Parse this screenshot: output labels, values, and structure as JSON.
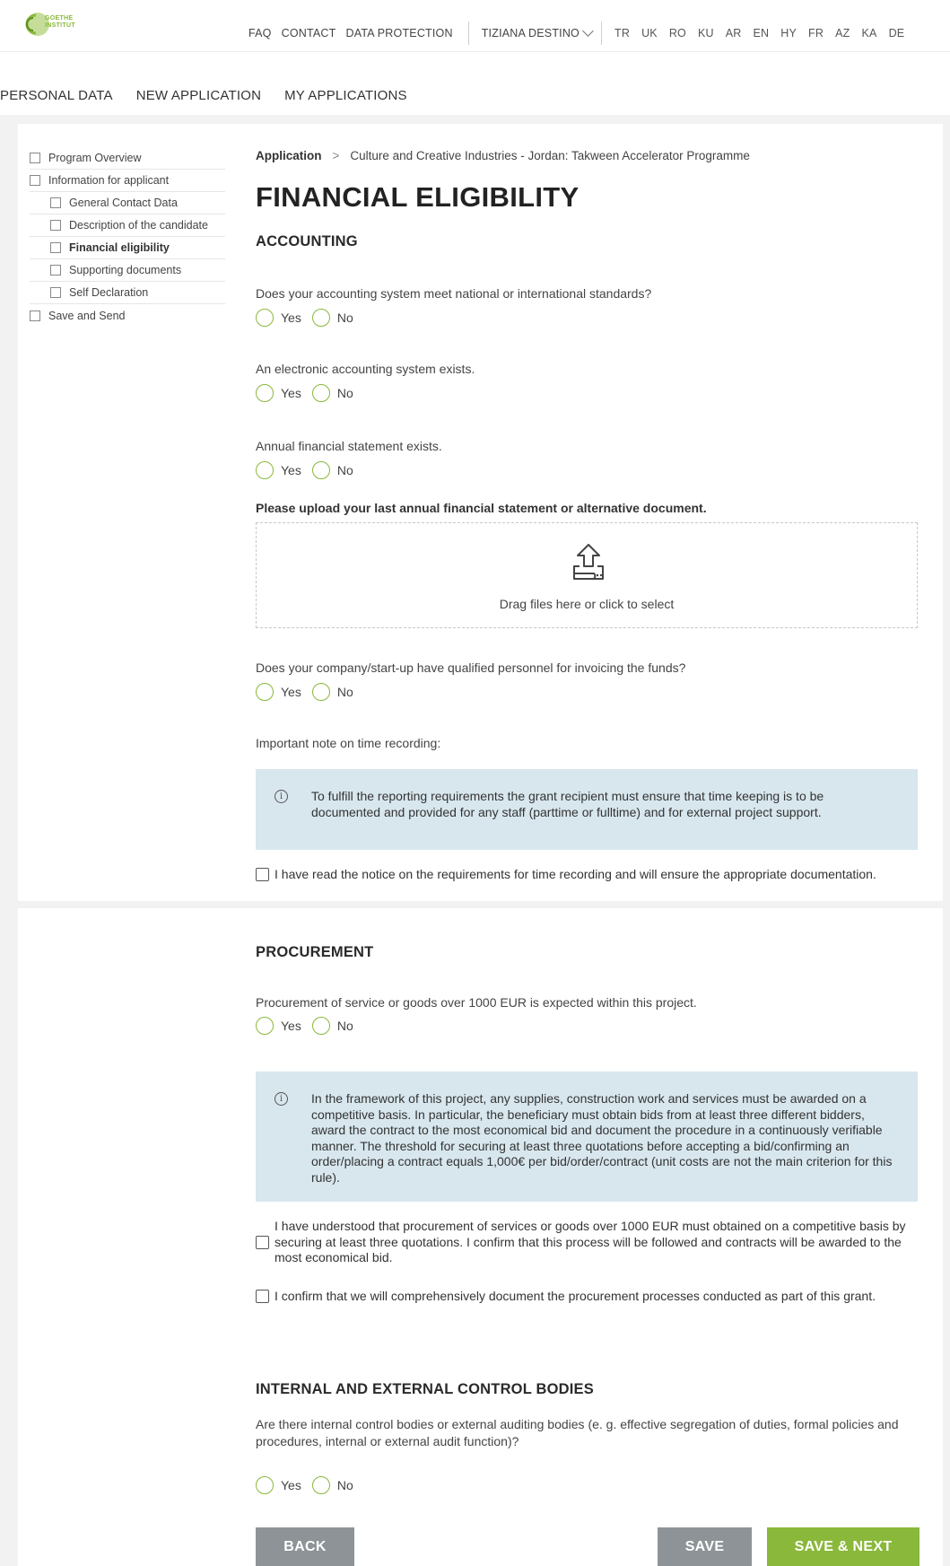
{
  "header": {
    "logo_text_1": "GOETHE",
    "logo_text_2": "INSTITUT",
    "links": [
      "FAQ",
      "CONTACT",
      "DATA PROTECTION"
    ],
    "user": "TIZIANA DESTINO",
    "languages": [
      "TR",
      "UK",
      "RO",
      "KU",
      "AR",
      "EN",
      "HY",
      "FR",
      "AZ",
      "KA",
      "DE"
    ]
  },
  "main_tabs": [
    "PERSONAL DATA",
    "NEW APPLICATION",
    "MY APPLICATIONS"
  ],
  "sidebar": {
    "items": [
      {
        "label": "Program Overview"
      },
      {
        "label": "Information for applicant"
      },
      {
        "label": "General Contact Data"
      },
      {
        "label": "Description of the candidate"
      },
      {
        "label": "Financial eligibility"
      },
      {
        "label": "Supporting documents"
      },
      {
        "label": "Self Declaration"
      },
      {
        "label": "Save and Send"
      }
    ]
  },
  "breadcrumb": {
    "first": "Application",
    "separator": ">",
    "second": "Culture and Creative Industries - Jordan: Takween Accelerator Programme"
  },
  "page_title": "FINANCIAL ELIGIBILITY",
  "accounting": {
    "title": "ACCOUNTING",
    "q1": "Does your accounting system meet national or international standards?",
    "q2": "An electronic accounting system exists.",
    "q3": "Annual financial statement exists.",
    "upload_label": "Please upload your last annual financial statement or alternative document.",
    "upload_hint": "Drag files here or click to select",
    "q4": "Does your company/start-up have qualified personnel for invoicing the funds?",
    "note_label": "Important note on time recording:",
    "notice": "To fulfill the reporting requirements the grant recipient must ensure that time keeping is to be documented and provided for any staff (parttime or fulltime) and for external project support.",
    "confirm": "I have read the notice on the requirements for time recording and will ensure the appropriate documentation."
  },
  "procurement": {
    "title": "PROCUREMENT",
    "q1": "Procurement of service or goods over 1000 EUR is expected within this project.",
    "notice": "In the framework of this project, any supplies, construction work and services must be awarded on a competitive basis. In particular, the beneficiary must obtain bids from at least three different bidders, award the contract to the most economical bid and document the procedure in a continuously verifiable manner. The threshold for securing at least three quotations before accepting a bid/confirming an order/placing a contract equals 1,000€ per bid/order/contract (unit costs are not the main criterion for this rule).",
    "confirm1": "I have understood that procurement of services or goods over 1000 EUR must obtained on a competitive basis by securing at least three quotations. I confirm that this process will be followed and contracts will be awarded to the most economical bid.",
    "confirm2": "I confirm that we will comprehensively document the procurement processes conducted as part of this grant."
  },
  "control": {
    "title": "INTERNAL AND EXTERNAL CONTROL BODIES",
    "q1": "Are there internal control bodies or external auditing bodies (e. g. effective segregation of duties, formal policies and procedures, internal or external audit function)?"
  },
  "radio_labels": {
    "yes": "Yes",
    "no": "No"
  },
  "buttons": {
    "back": "BACK",
    "save": "SAVE",
    "save_next": "SAVE & NEXT"
  },
  "colors": {
    "accent": "#8ab83a",
    "button_gray": "#8d9396",
    "notice_bg": "#d8e7ee",
    "frame": "#f2f2f2"
  },
  "icons": [
    "goethe-logo-icon",
    "chevron-down-icon",
    "upload-icon",
    "info-icon"
  ]
}
